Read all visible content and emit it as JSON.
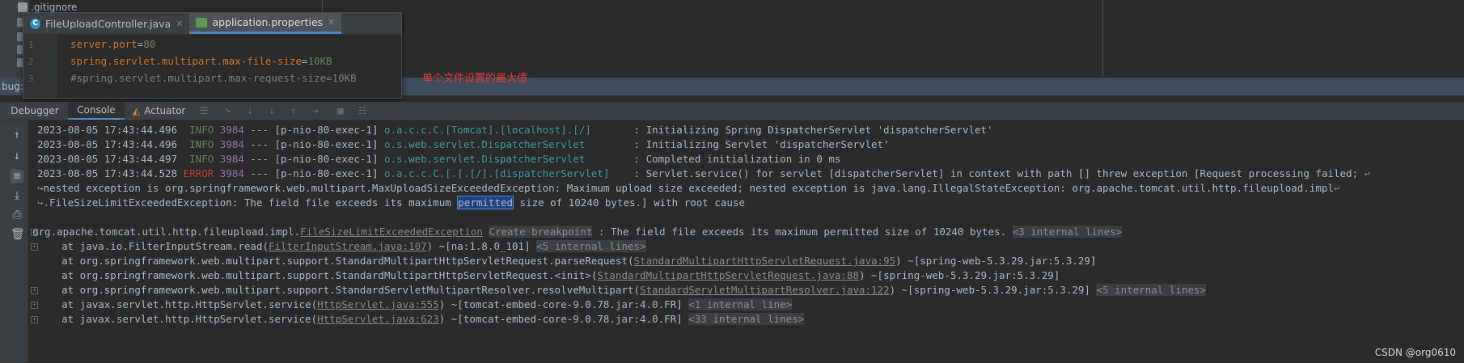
{
  "project_tree": {
    "gitignore": ".gitignore"
  },
  "popup": {
    "tabs": [
      {
        "label": "FileUploadController.java",
        "active": false
      },
      {
        "label": "application.properties",
        "active": true
      }
    ],
    "lines": [
      {
        "num": "1",
        "key": "server.port",
        "eq": "=",
        "value": "80"
      },
      {
        "num": "2",
        "key": "spring.servlet.multipart.max-file-size",
        "eq": "=",
        "value": "10KB"
      },
      {
        "num": "3",
        "comment": "#spring.servlet.multipart.max-request-size=10KB"
      }
    ]
  },
  "annotation": "单个文件设置的最大值",
  "debug": {
    "label": "bug:"
  },
  "tabs": {
    "debugger": "Debugger",
    "console": "Console",
    "actuator": "Actuator"
  },
  "console": {
    "log": [
      {
        "ts": "2023-08-05 17:43:44.496",
        "level": "INFO",
        "pid": "3984",
        "thread": " --- [p-nio-80-exec-1] ",
        "logger": "o.a.c.c.C.[Tomcat].[localhost].[/]      ",
        "msg": " : Initializing Spring DispatcherServlet 'dispatcherServlet'"
      },
      {
        "ts": "2023-08-05 17:43:44.496",
        "level": "INFO",
        "pid": "3984",
        "thread": " --- [p-nio-80-exec-1] ",
        "logger": "o.s.web.servlet.DispatcherServlet       ",
        "msg": " : Initializing Servlet 'dispatcherServlet'"
      },
      {
        "ts": "2023-08-05 17:43:44.497",
        "level": "INFO",
        "pid": "3984",
        "thread": " --- [p-nio-80-exec-1] ",
        "logger": "o.s.web.servlet.DispatcherServlet       ",
        "msg": " : Completed initialization in 0 ms"
      },
      {
        "ts": "2023-08-05 17:43:44.528",
        "level": "ERROR",
        "pid": "3984",
        "thread": " --- [p-nio-80-exec-1] ",
        "logger": "o.a.c.c.C.[.[.[/].[dispatcherServlet]   ",
        "msg": " : Servlet.service() for servlet [dispatcherServlet] in context with path [] threw exception [Request processing failed;"
      }
    ],
    "wrap1": "nested exception is org.springframework.web.multipart.MaxUploadSizeExceededException: Maximum upload size exceeded; nested exception is java.lang.IllegalStateException: org.apache.tomcat.util.http.fileupload.impl",
    "wrap2_pre": ".FileSizeLimitExceededException: The field file exceeds its maximum ",
    "wrap2_sel": "permitted",
    "wrap2_post": " size of 10240 bytes.] with root cause",
    "exception": {
      "pkg": "org.apache.tomcat.util.http.fileupload.impl.",
      "cls": "FileSizeLimitExceededException",
      "bp": "Create breakpoint",
      "msg": " : The field file exceeds its maximum permitted size of 10240 bytes. ",
      "internal": "<3 internal lines>"
    },
    "stack": [
      {
        "pre": "    at java.io.FilterInputStream.read(",
        "link": "FilterInputStream.java:107",
        "post": ") ~[na:1.8.0_101] ",
        "internal": "<5 internal lines>"
      },
      {
        "pre": "    at org.springframework.web.multipart.support.StandardMultipartHttpServletRequest.parseRequest(",
        "link": "StandardMultipartHttpServletRequest.java:95",
        "post": ") ~[spring-web-5.3.29.jar:5.3.29]",
        "internal": ""
      },
      {
        "pre": "    at org.springframework.web.multipart.support.StandardMultipartHttpServletRequest.<init>(",
        "link": "StandardMultipartHttpServletRequest.java:88",
        "post": ") ~[spring-web-5.3.29.jar:5.3.29]",
        "internal": ""
      },
      {
        "pre": "    at org.springframework.web.multipart.support.StandardServletMultipartResolver.resolveMultipart(",
        "link": "StandardServletMultipartResolver.java:122",
        "post": ") ~[spring-web-5.3.29.jar:5.3.29] ",
        "internal": "<5 internal lines>"
      },
      {
        "pre": "    at javax.servlet.http.HttpServlet.service(",
        "link": "HttpServlet.java:555",
        "post": ") ~[tomcat-embed-core-9.0.78.jar:4.0.FR] ",
        "internal": "<1 internal line>"
      },
      {
        "pre": "    at javax.servlet.http.HttpServlet.service(",
        "link": "HttpServlet.java:623",
        "post": ") ~[tomcat-embed-core-9.0.78.jar:4.0.FR] ",
        "internal": "<33 internal lines>"
      }
    ]
  },
  "watermark": "CSDN @org0610"
}
